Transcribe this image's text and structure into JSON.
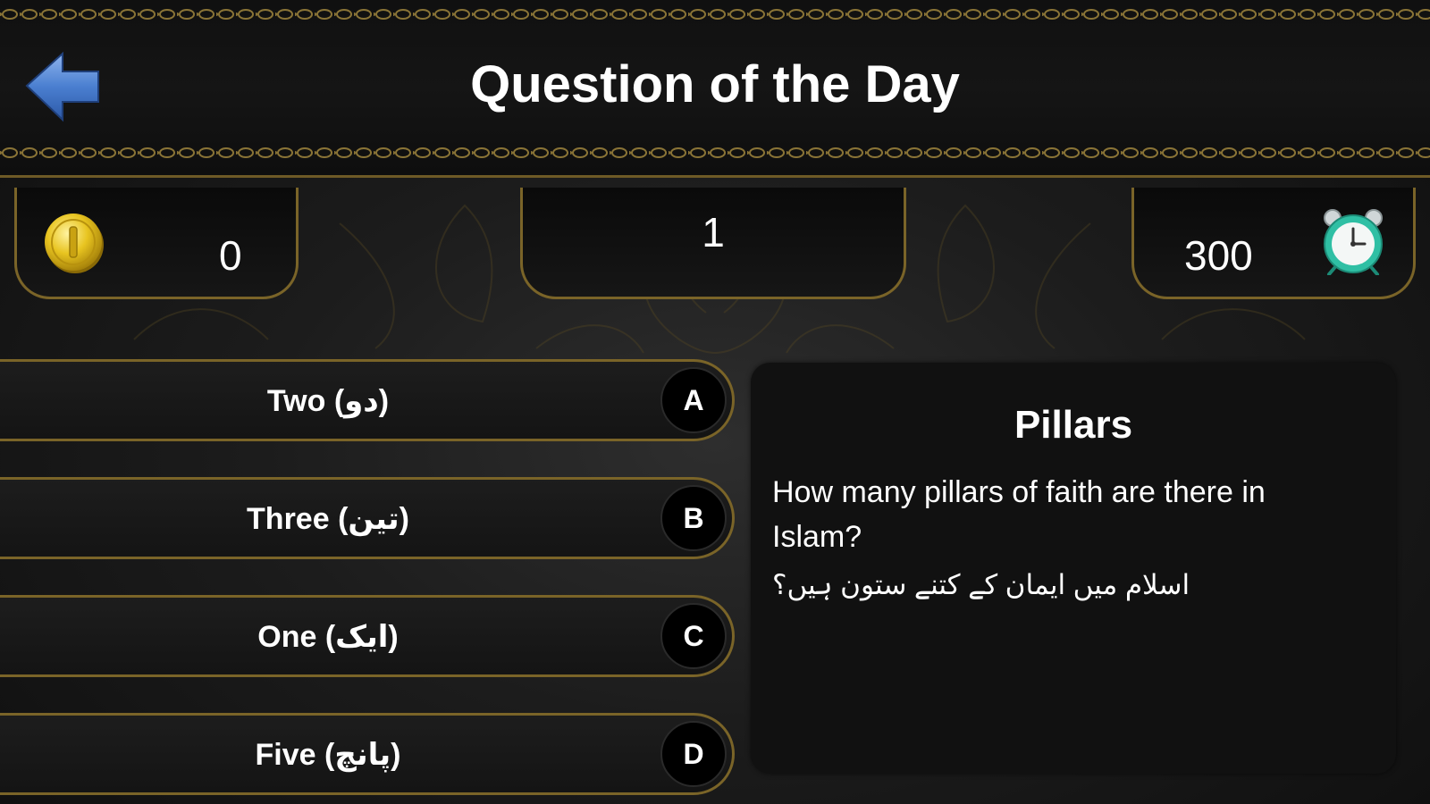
{
  "header": {
    "title": "Question of the Day"
  },
  "stats": {
    "coins": "0",
    "question_number": "1",
    "timer": "300"
  },
  "options": [
    {
      "letter": "A",
      "label": "Two (دو)"
    },
    {
      "letter": "B",
      "label": "Three (تین)"
    },
    {
      "letter": "C",
      "label": "One (ایک)"
    },
    {
      "letter": "D",
      "label": "Five (پانچ)"
    }
  ],
  "question": {
    "category": "Pillars",
    "text_en": "How many pillars of faith are there in Islam?",
    "text_ur": "اسلام میں ایمان کے کتنے ستون ہیں؟"
  },
  "icons": {
    "back": "back-arrow-icon",
    "coin": "coin-icon",
    "clock": "alarm-clock-icon"
  },
  "colors": {
    "background": "#141414",
    "gold_border": "#7a6428",
    "back_arrow": "#4a7fd0",
    "coin": "#e8c420",
    "clock": "#2fbfa4",
    "text": "#ffffff"
  }
}
